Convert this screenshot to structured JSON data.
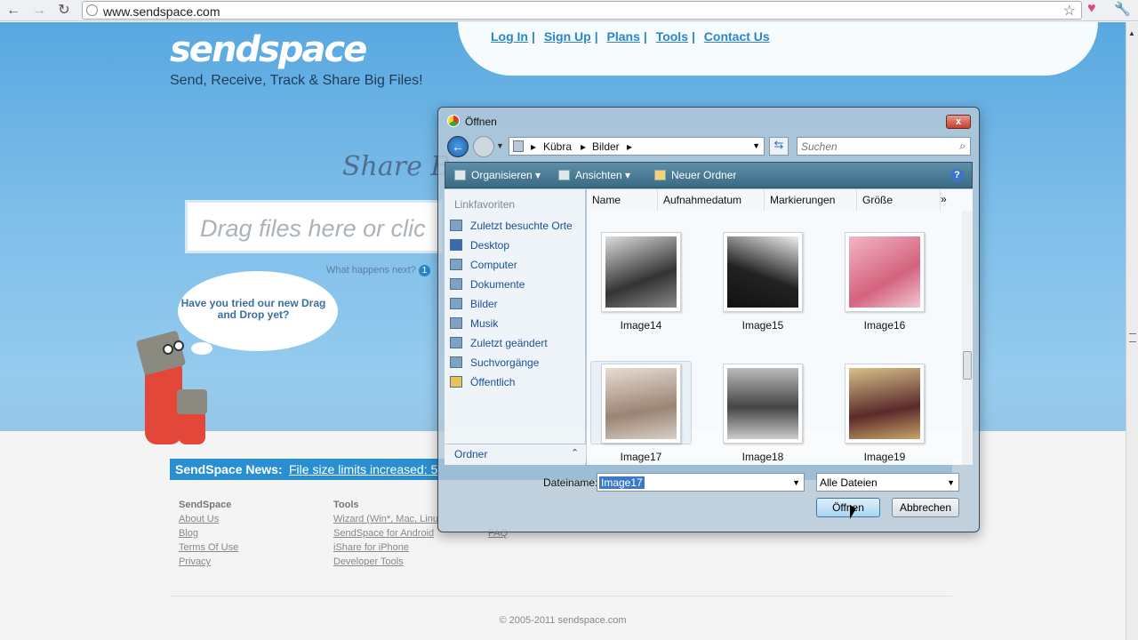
{
  "browser": {
    "url": "www.sendspace.com",
    "back_icon": "arrow-left-icon",
    "forward_icon": "arrow-right-icon",
    "reload_icon": "reload-icon"
  },
  "site": {
    "logo": "sendspace",
    "tagline": "Send, Receive, Track & Share Big Files!",
    "nav": [
      "Log In",
      "Sign Up",
      "Plans",
      "Tools",
      "Contact Us"
    ],
    "share_title": "Share B",
    "drop_placeholder": "Drag files here or clic",
    "what_next": "What happens next?",
    "what_next_num": "1",
    "bubble": "Have you tried our new Drag and Drop yet?",
    "news_label": "SendSpace News:",
    "news_text": "File size limits increased: 5",
    "footer": {
      "col1": {
        "head": "SendSpace",
        "links": [
          "About Us",
          "Blog",
          "Terms Of Use",
          "Privacy"
        ]
      },
      "col2": {
        "head": "Tools",
        "links": [
          "Wizard (Win*, Mac, Linu",
          "SendSpace for Android",
          "iShare for iPhone",
          "Developer Tools"
        ]
      },
      "col3": {
        "links": [
          "FAQ"
        ]
      }
    },
    "copyright": "© 2005-2011 sendspace.com"
  },
  "dialog": {
    "title": "Öffnen",
    "close": "x",
    "breadcrumb": [
      "Kübra",
      "Bilder"
    ],
    "search_placeholder": "Suchen",
    "toolbar": {
      "organize": "Organisieren",
      "views": "Ansichten",
      "new_folder": "Neuer Ordner",
      "help": "?"
    },
    "nav_caption": "Linkfavoriten",
    "nav_items": [
      "Zuletzt besuchte Orte",
      "Desktop",
      "Computer",
      "Dokumente",
      "Bilder",
      "Musik",
      "Zuletzt geändert",
      "Suchvorgänge",
      "Öffentlich"
    ],
    "folders_label": "Ordner",
    "columns": [
      "Name",
      "Aufnahmedatum",
      "Markierungen",
      "Größe"
    ],
    "more_columns": "»",
    "files": [
      "Image14",
      "Image15",
      "Image16",
      "Image17",
      "Image18",
      "Image19"
    ],
    "filename_label": "Dateiname:",
    "filename_value": "Image17",
    "filetype": "Alle Dateien",
    "open_button": "Öffnen",
    "cancel_button": "Abbrechen"
  }
}
